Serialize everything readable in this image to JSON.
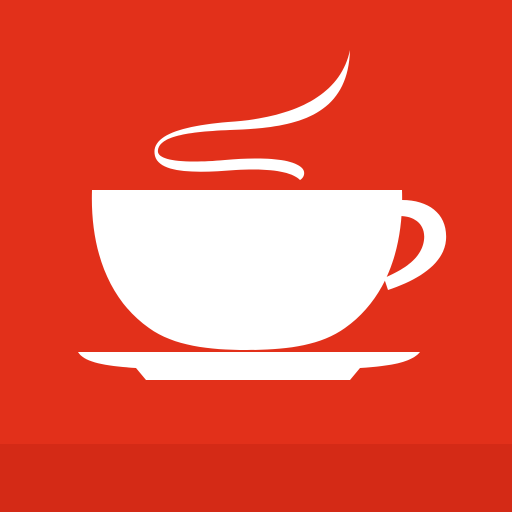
{
  "icon": {
    "name": "coffee-cup-icon",
    "colors": {
      "background": "#e2301a",
      "bottom_band": "#d42a16",
      "glyph": "#ffffff"
    }
  }
}
